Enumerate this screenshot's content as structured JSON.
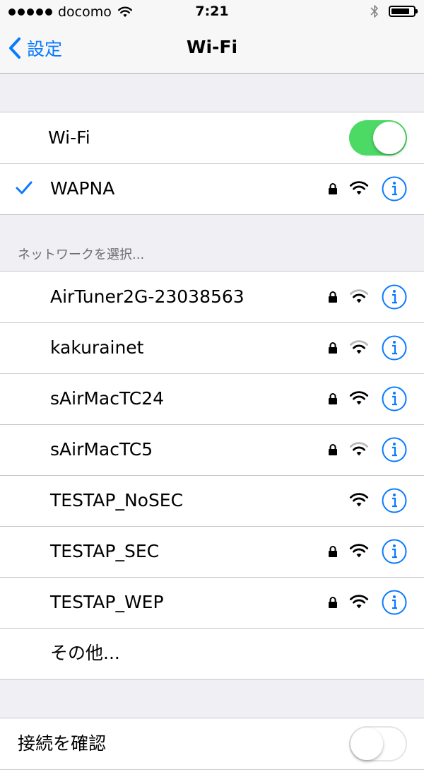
{
  "status_bar": {
    "carrier": "docomo",
    "time": "7:21"
  },
  "nav": {
    "back_label": "設定",
    "title": "Wi-Fi"
  },
  "wifi_toggle": {
    "label": "Wi-Fi",
    "on": true
  },
  "connected": {
    "name": "WAPNA"
  },
  "section_header": "ネットワークを選択...",
  "networks": [
    {
      "name": "AirTuner2G-23038563",
      "secured": true,
      "signal": "weak"
    },
    {
      "name": "kakurainet",
      "secured": true,
      "signal": "weak"
    },
    {
      "name": "sAirMacTC24",
      "secured": true,
      "signal": "full"
    },
    {
      "name": "sAirMacTC5",
      "secured": true,
      "signal": "weak"
    },
    {
      "name": "TESTAP_NoSEC",
      "secured": false,
      "signal": "full"
    },
    {
      "name": "TESTAP_SEC",
      "secured": true,
      "signal": "full"
    },
    {
      "name": "TESTAP_WEP",
      "secured": true,
      "signal": "full"
    }
  ],
  "other_label": "その他...",
  "ask_to_join": {
    "label": "接続を確認",
    "on": false
  },
  "colors": {
    "accent": "#0a7aff",
    "toggle_on": "#4cd964",
    "separator": "#c8c7cc",
    "background": "#efeff4"
  },
  "icons": [
    "wifi-icon",
    "lock-icon",
    "info-icon",
    "checkmark-icon",
    "chevron-left-icon",
    "bluetooth-icon",
    "battery-icon"
  ]
}
